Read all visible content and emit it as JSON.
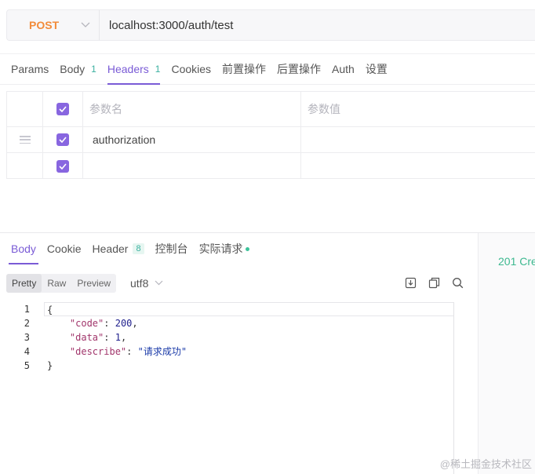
{
  "request": {
    "method": "POST",
    "url": "localhost:3000/auth/test"
  },
  "request_tabs": [
    {
      "label": "Params",
      "count": ""
    },
    {
      "label": "Body",
      "count": "1"
    },
    {
      "label": "Headers",
      "count": "1",
      "active": true
    },
    {
      "label": "Cookies",
      "count": ""
    },
    {
      "label": "前置操作",
      "count": ""
    },
    {
      "label": "后置操作",
      "count": ""
    },
    {
      "label": "Auth",
      "count": ""
    },
    {
      "label": "设置",
      "count": ""
    }
  ],
  "headers_table": {
    "key_header": "参数名",
    "value_header": "参数值",
    "rows": [
      {
        "key": "authorization",
        "value": "",
        "checked": true
      },
      {
        "key": "",
        "value": "",
        "checked": true
      }
    ]
  },
  "response": {
    "tabs": [
      {
        "label": "Body",
        "active": true
      },
      {
        "label": "Cookie"
      },
      {
        "label": "Header",
        "badge": "8"
      },
      {
        "label": "控制台"
      },
      {
        "label": "实际请求",
        "dot": true
      }
    ],
    "view_modes": [
      "Pretty",
      "Raw",
      "Preview"
    ],
    "active_view": "Pretty",
    "encoding": "utf8",
    "status": "201 Cre",
    "line_numbers": [
      "1",
      "2",
      "3",
      "4",
      "5"
    ],
    "body": {
      "open_brace": "{",
      "close_brace": "}",
      "entries": [
        {
          "key": "\"code\"",
          "value": "200",
          "type": "number",
          "comma": ","
        },
        {
          "key": "\"data\"",
          "value": "1",
          "type": "number",
          "comma": ","
        },
        {
          "key": "\"describe\"",
          "value": "\"请求成功\"",
          "type": "string",
          "comma": ""
        }
      ]
    }
  },
  "watermark": "@稀土掘金技术社区",
  "colors": {
    "accent": "#7a5bd6",
    "method_post": "#f28b3a",
    "success": "#3cb88f"
  }
}
